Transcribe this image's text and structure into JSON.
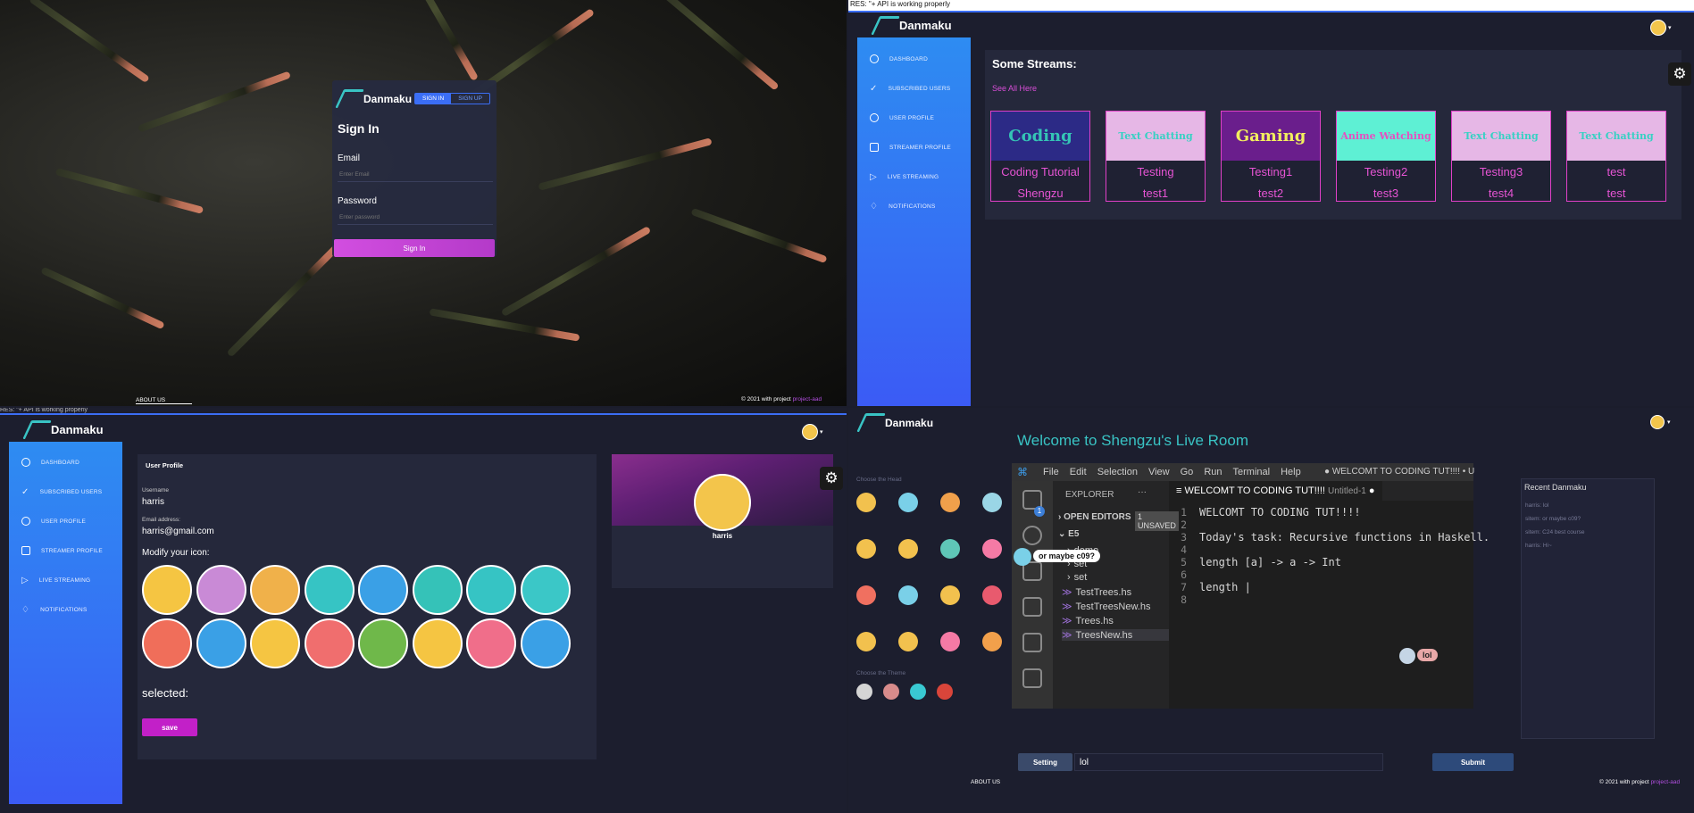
{
  "signin": {
    "brand": "Danmaku",
    "tab_signin": "SIGN IN",
    "tab_signup": "SIGN UP",
    "title": "Sign In",
    "email_label": "Email",
    "email_placeholder": "Enter Email",
    "password_label": "Password",
    "password_placeholder": "Enter password",
    "button": "Sign In",
    "footer_about": "ABOUT US",
    "footer_copy": "© 2021 with project",
    "footer_project": "project-aad"
  },
  "status_bar": {
    "text": "RES: \"+ API is working properly"
  },
  "sidebar": {
    "items": [
      {
        "label": "DASHBOARD",
        "icon": "dashboard-icon"
      },
      {
        "label": "SUBSCRIBED USERS",
        "icon": "check-icon"
      },
      {
        "label": "USER PROFILE",
        "icon": "user-icon"
      },
      {
        "label": "STREAMER PROFILE",
        "icon": "id-card-icon"
      },
      {
        "label": "LIVE STREAMING",
        "icon": "play-icon"
      },
      {
        "label": "NOTIFICATIONS",
        "icon": "bell-icon"
      }
    ]
  },
  "dashboard": {
    "brand": "Danmaku",
    "heading": "Some Streams:",
    "see_all": "See All Here",
    "streams": [
      {
        "thumb": "Coding",
        "title": "Coding Tutorial",
        "user": "Shengzu",
        "bg": "#2c2a86",
        "fg": "#35c4b5"
      },
      {
        "thumb": "Text Chatting",
        "title": "Testing",
        "user": "test1",
        "bg": "#e6b7e6",
        "fg": "#37d1c3"
      },
      {
        "thumb": "Gaming",
        "title": "Testing1",
        "user": "test2",
        "bg": "#6a1e8c",
        "fg": "#f2ee5e"
      },
      {
        "thumb": "Anime Watching",
        "title": "Testing2",
        "user": "test3",
        "bg": "#5ef0d4",
        "fg": "#e64fc0"
      },
      {
        "thumb": "Text Chatting",
        "title": "Testing3",
        "user": "test4",
        "bg": "#e6b7e6",
        "fg": "#37d1c3"
      },
      {
        "thumb": "Text Chatting",
        "title": "test",
        "user": "test",
        "bg": "#e6b7e6",
        "fg": "#37d1c3"
      }
    ]
  },
  "profile": {
    "brand": "Danmaku",
    "card_title": "User Profile",
    "username_label": "Username",
    "username": "harris",
    "email_label": "Email address:",
    "email": "harris@gmail.com",
    "modify_label": "Modify your icon:",
    "selected_label": "selected:",
    "save": "save",
    "side_name": "harris",
    "icons": [
      {
        "name": "penguin-icon",
        "bg": "#f5c542"
      },
      {
        "name": "seal-icon",
        "bg": "#c98ad6"
      },
      {
        "name": "lion-icon",
        "bg": "#f0b14a"
      },
      {
        "name": "polar-bear-icon",
        "bg": "#36c4c4"
      },
      {
        "name": "bird-icon",
        "bg": "#3aa0e6"
      },
      {
        "name": "owl-icon",
        "bg": "#35c2b8"
      },
      {
        "name": "elephant-icon",
        "bg": "#36c4c4"
      },
      {
        "name": "starfish-icon",
        "bg": "#3bc7c7"
      },
      {
        "name": "crab-icon",
        "bg": "#f06e5a"
      },
      {
        "name": "monkey-icon",
        "bg": "#3aa0e6"
      },
      {
        "name": "cat-icon",
        "bg": "#f5c542"
      },
      {
        "name": "gorilla-icon",
        "bg": "#f06e6e"
      },
      {
        "name": "lion2-icon",
        "bg": "#6fb84a"
      },
      {
        "name": "koala-icon",
        "bg": "#f5c542"
      },
      {
        "name": "rabbit-icon",
        "bg": "#f06e8a"
      },
      {
        "name": "tiger-icon",
        "bg": "#3aa0e6"
      }
    ]
  },
  "live": {
    "brand": "Danmaku",
    "title": "Welcome to Shengzu's Live Room",
    "choose_head": "Choose the Head",
    "choose_theme": "Choose the Theme",
    "themes": [
      "#d5d5d5",
      "#d88b8b",
      "#39c9d2",
      "#d9453a"
    ],
    "heads": [
      "#f2c14e",
      "#7ad0e8",
      "#f0a04b",
      "#9ad6e6",
      "#f2c14e",
      "#f2c14e",
      "#5fc6b7",
      "#f57aa5",
      "#f07060",
      "#7ad0e8",
      "#f2c14e",
      "#e85a6e",
      "#f2c14e",
      "#f2c14e",
      "#f57aa5",
      "#f2a04b"
    ],
    "recent_title": "Recent Danmaku",
    "recent": [
      "harris: lol",
      "sitem: or maybe c09?",
      "sitem: C24 best course",
      "harris: Hi~"
    ],
    "setting": "Setting",
    "input_value": "lol",
    "submit": "Submit",
    "footer_about": "ABOUT US",
    "footer_copy": "© 2021 with project",
    "footer_project": "project-aad",
    "bubble1": "or maybe c09?",
    "bubble2": "lol",
    "vscode": {
      "menu": [
        "File",
        "Edit",
        "Selection",
        "View",
        "Go",
        "Run",
        "Terminal",
        "Help"
      ],
      "window_title": "● WELCOMT TO CODING TUT!!!! • U",
      "explorer": "EXPLORER",
      "open_editors": "OPEN EDITORS",
      "unsaved": "1 UNSAVED",
      "folder": "E5",
      "files": [
        "demo",
        "set",
        "set",
        "TestTrees.hs",
        "TestTreesNew.hs",
        "Trees.hs",
        "TreesNew.hs"
      ],
      "tab": "WELCOMT TO CODING TUT!!!!",
      "tab_sub": "Untitled-1",
      "lines": [
        "WELCOMT TO CODING TUT!!!!",
        "",
        "Today's task: Recursive functions in Haskell.",
        "",
        "length [a] -> a -> Int",
        "",
        "length |",
        ""
      ],
      "line_numbers": [
        "1",
        "2",
        "3",
        "4",
        "5",
        "6",
        "7",
        "8"
      ],
      "badge": "1"
    }
  }
}
